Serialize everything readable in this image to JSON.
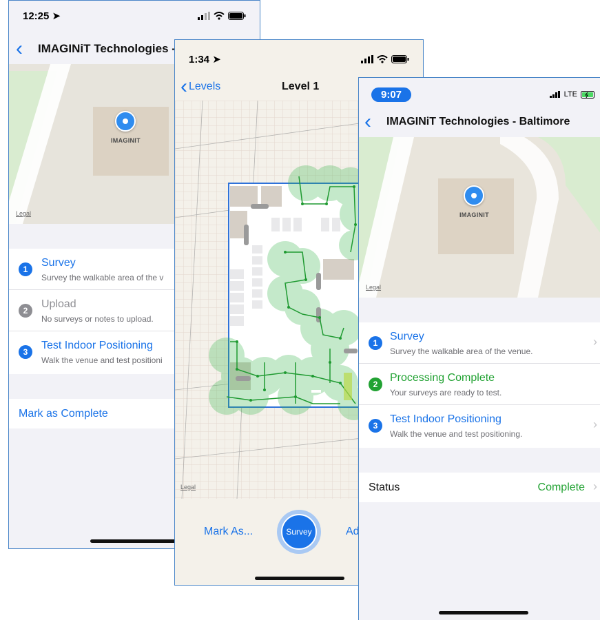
{
  "screen_left": {
    "status_time": "12:25",
    "nav_title": "IMAGINiT Technologies -",
    "map_pin_label": "IMAGINIT",
    "map_legal": "Legal",
    "rows": [
      {
        "number": "1",
        "title": "Survey",
        "subtitle": "Survey the walkable area of the v"
      },
      {
        "number": "2",
        "title": "Upload",
        "subtitle": "No surveys or notes to upload."
      },
      {
        "number": "3",
        "title": "Test Indoor Positioning",
        "subtitle": "Walk the venue and test positioni"
      }
    ],
    "mark_complete": "Mark as Complete"
  },
  "screen_middle": {
    "status_time": "1:34",
    "back_label": "Levels",
    "nav_title": "Level 1",
    "map_legal": "Legal",
    "toolbar": {
      "mark_as": "Mark As...",
      "survey": "Survey",
      "right_partial": "Ad"
    }
  },
  "screen_right": {
    "status_time": "9:07",
    "carrier": "LTE",
    "nav_title": "IMAGINiT Technologies - Baltimore",
    "map_pin_label": "IMAGINIT",
    "map_legal": "Legal",
    "rows": [
      {
        "number": "1",
        "title": "Survey",
        "subtitle": "Survey the walkable area of the venue."
      },
      {
        "number": "2",
        "title": "Processing Complete",
        "subtitle": "Your surveys are ready to test."
      },
      {
        "number": "3",
        "title": "Test Indoor Positioning",
        "subtitle": "Walk the venue and test positioning."
      }
    ],
    "status_label": "Status",
    "status_value": "Complete"
  },
  "colors": {
    "accent_blue": "#1a73e8",
    "success_green": "#22a233",
    "disabled_gray": "#8e8e93",
    "heatmap_green": "#2fb344"
  }
}
